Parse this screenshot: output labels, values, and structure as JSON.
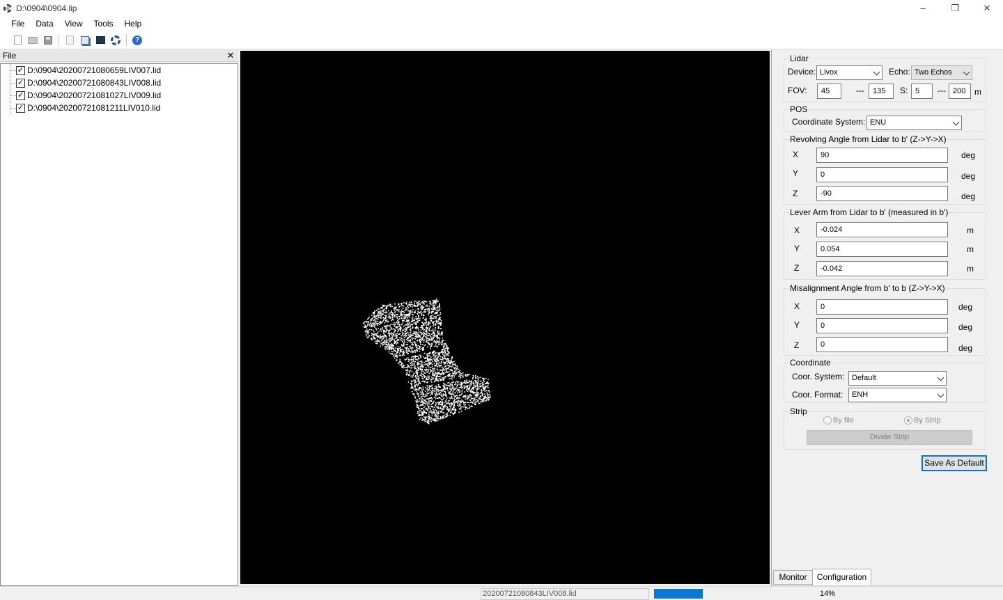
{
  "window": {
    "title": "D:\\0904\\0904.lip",
    "minimize": "–",
    "restore": "❐",
    "close": "✕"
  },
  "menu": [
    "File",
    "Data",
    "View",
    "Tools",
    "Help"
  ],
  "toolbar": {
    "icons": [
      "new-icon",
      "open-icon",
      "save-icon",
      "export-icon",
      "copy-icon",
      "monitor-icon",
      "settings-icon",
      "help-icon"
    ],
    "help_glyph": "?"
  },
  "file_panel": {
    "title": "File",
    "close_glyph": "✕",
    "files": [
      {
        "name": "D:\\0904\\20200721080659LIV007.lid",
        "checked": true
      },
      {
        "name": "D:\\0904\\20200721080843LIV008.lid",
        "checked": true
      },
      {
        "name": "D:\\0904\\20200721081027LIV009.lid",
        "checked": true
      },
      {
        "name": "D:\\0904\\20200721081211LIV010.lid",
        "checked": true
      }
    ],
    "check_glyph": "✓"
  },
  "config": {
    "lidar": {
      "title": "Lidar",
      "device_label": "Device:",
      "device_value": "Livox",
      "echo_label": "Echo:",
      "echo_value": "Two Echos",
      "fov_label": "FOV:",
      "fov_min": "45",
      "fov_sep": "---",
      "fov_max": "135",
      "s_label": "S:",
      "s_min": "5",
      "s_sep": "---",
      "s_max": "200",
      "s_unit": "m"
    },
    "pos": {
      "title": "POS",
      "cs_label": "Coordinate System:",
      "cs_value": "ENU"
    },
    "revolving": {
      "title": "Revolving Angle from Lidar to b' (Z->Y->X)",
      "x_label": "X",
      "x_value": "90",
      "x_unit": "deg",
      "y_label": "Y",
      "y_value": "0",
      "y_unit": "deg",
      "z_label": "Z",
      "z_value": "-90",
      "z_unit": "deg"
    },
    "lever": {
      "title": "Lever Arm from Lidar to b' (measured in b')",
      "x_label": "X",
      "x_value": "-0.024",
      "x_unit": "m",
      "y_label": "Y",
      "y_value": "0.054",
      "y_unit": "m",
      "z_label": "Z",
      "z_value": "-0.042",
      "z_unit": "m"
    },
    "misalign": {
      "title": "Misalignment Angle from b' to b (Z->Y->X)",
      "x_label": "X",
      "x_value": "0",
      "x_unit": "deg",
      "y_label": "Y",
      "y_value": "0",
      "y_unit": "deg",
      "z_label": "Z",
      "z_value": "0",
      "z_unit": "deg"
    },
    "coordinate": {
      "title": "Coordinate",
      "system_label": "Coor. System:",
      "system_value": "Default",
      "format_label": "Coor. Format:",
      "format_value": "ENH"
    },
    "strip": {
      "title": "Strip",
      "by_file": "By file",
      "by_strip": "By Strip",
      "divide": "Divide Strip"
    },
    "save_default": "Save As Default",
    "tabs": [
      "Monitor",
      "Configuration"
    ],
    "active_tab": "Configuration"
  },
  "status": {
    "file": "20200721080843LIV008.lid",
    "progress_percent": 14,
    "progress_text": "14%",
    "progress_color": "#0a78d7"
  }
}
